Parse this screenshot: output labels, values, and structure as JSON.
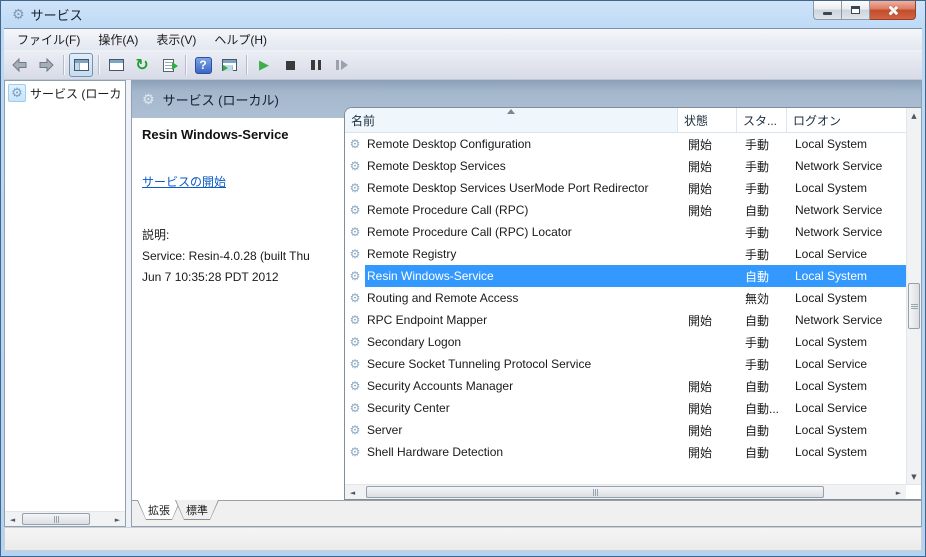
{
  "window": {
    "title": "サービス"
  },
  "window_controls": {
    "minimize": "minimize",
    "restore": "restore",
    "close": "close"
  },
  "menu": {
    "items": [
      "ファイル(F)",
      "操作(A)",
      "表示(V)",
      "ヘルプ(H)"
    ]
  },
  "toolbar": {
    "icons": [
      "back-icon",
      "forward-icon",
      "show-console-tree-icon",
      "properties-icon",
      "refresh-icon",
      "export-list-icon",
      "help-icon",
      "show-action-pane-icon",
      "start-service-icon",
      "stop-service-icon",
      "pause-service-icon",
      "restart-service-icon"
    ]
  },
  "tree": {
    "root_label": "サービス (ローカ"
  },
  "main": {
    "header": "サービス (ローカル)",
    "description": {
      "service_name": "Resin Windows-Service",
      "start_link": "サービスの開始",
      "description_label": "説明:",
      "description_line1": "Service: Resin-4.0.28 (built Thu",
      "description_line2": "Jun  7 10:35:28 PDT 2012"
    },
    "table": {
      "columns": [
        "名前",
        "状態",
        "スタ...",
        "ログオン"
      ],
      "sorted_column": "名前",
      "rows": [
        {
          "name": "Remote Desktop Configuration",
          "status": "開始",
          "startup": "手動",
          "logon": "Local System",
          "selected": false
        },
        {
          "name": "Remote Desktop Services",
          "status": "開始",
          "startup": "手動",
          "logon": "Network Service",
          "selected": false
        },
        {
          "name": "Remote Desktop Services UserMode Port Redirector",
          "status": "開始",
          "startup": "手動",
          "logon": "Local System",
          "selected": false
        },
        {
          "name": "Remote Procedure Call (RPC)",
          "status": "開始",
          "startup": "自動",
          "logon": "Network Service",
          "selected": false
        },
        {
          "name": "Remote Procedure Call (RPC) Locator",
          "status": "",
          "startup": "手動",
          "logon": "Network Service",
          "selected": false
        },
        {
          "name": "Remote Registry",
          "status": "",
          "startup": "手動",
          "logon": "Local Service",
          "selected": false
        },
        {
          "name": "Resin Windows-Service",
          "status": "",
          "startup": "自動",
          "logon": "Local System",
          "selected": true
        },
        {
          "name": "Routing and Remote Access",
          "status": "",
          "startup": "無効",
          "logon": "Local System",
          "selected": false
        },
        {
          "name": "RPC Endpoint Mapper",
          "status": "開始",
          "startup": "自動",
          "logon": "Network Service",
          "selected": false
        },
        {
          "name": "Secondary Logon",
          "status": "",
          "startup": "手動",
          "logon": "Local System",
          "selected": false
        },
        {
          "name": "Secure Socket Tunneling Protocol Service",
          "status": "",
          "startup": "手動",
          "logon": "Local Service",
          "selected": false
        },
        {
          "name": "Security Accounts Manager",
          "status": "開始",
          "startup": "自動",
          "logon": "Local System",
          "selected": false
        },
        {
          "name": "Security Center",
          "status": "開始",
          "startup": "自動...",
          "logon": "Local Service",
          "selected": false
        },
        {
          "name": "Server",
          "status": "開始",
          "startup": "自動",
          "logon": "Local System",
          "selected": false
        },
        {
          "name": "Shell Hardware Detection",
          "status": "開始",
          "startup": "自動",
          "logon": "Local System",
          "selected": false
        }
      ]
    },
    "tabs": [
      {
        "label": "拡張",
        "active": true
      },
      {
        "label": "標準",
        "active": false
      }
    ]
  },
  "colors": {
    "selection": "#3399ff",
    "header_band": "#a4b7cc",
    "titlebar": "#bcd9f6",
    "link": "#0a5bc4",
    "close_button": "#c04f30"
  }
}
